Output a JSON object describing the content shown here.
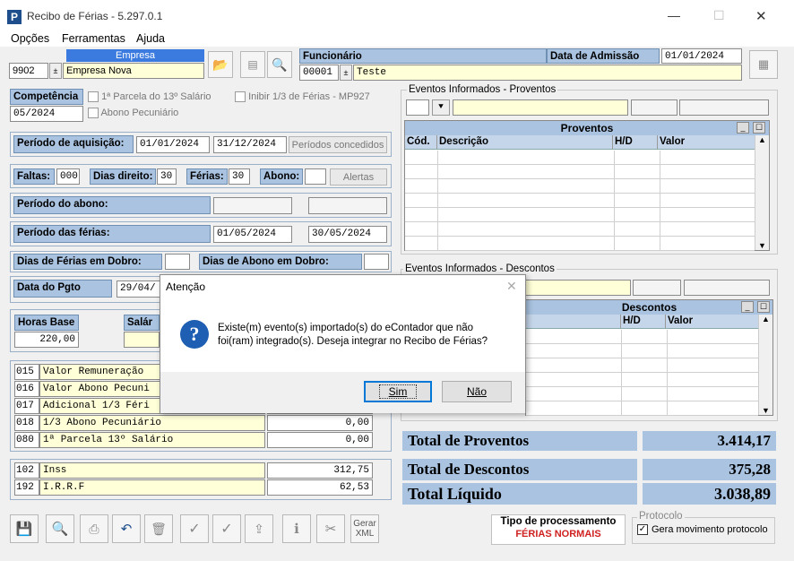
{
  "window": {
    "title": "Recibo de Férias - 5.297.0.1",
    "minimize": "—",
    "maximize": "☐",
    "close": "✕"
  },
  "menu": [
    "Opções",
    "Ferramentas",
    "Ajuda"
  ],
  "empresa": {
    "label": "Empresa",
    "code": "9902",
    "name": "Empresa Nova"
  },
  "funcionario": {
    "label": "Funcionário",
    "code": "00001",
    "name": "Teste"
  },
  "admissao": {
    "label": "Data de Admissão",
    "value": "01/01/2024"
  },
  "competencia": {
    "label": "Competência",
    "value": "05/2024",
    "parcela13_label": "1ª Parcela do 13º Salário",
    "abono_label": "Abono Pecuniário",
    "inibir_label": "Inibir 1/3 de Férias - MP927"
  },
  "aquisicao": {
    "label": "Período de aquisição:",
    "start": "01/01/2024",
    "end": "31/12/2024",
    "button": "Períodos concedidos"
  },
  "faltas": {
    "faltas_label": "Faltas:",
    "faltas_value": "000",
    "direito_label": "Dias direito:",
    "direito_value": "30",
    "ferias_label": "Férias:",
    "ferias_value": "30",
    "abono_label": "Abono:",
    "abono_value": "",
    "alertas_button": "Alertas"
  },
  "periodo_abono": {
    "label": "Período do abono:"
  },
  "periodo_ferias": {
    "label": "Período das férias:",
    "start": "01/05/2024",
    "end": "30/05/2024"
  },
  "dobro": {
    "ferias_label": "Dias de Férias em Dobro:",
    "abono_label": "Dias de Abono em Dobro:"
  },
  "pagto": {
    "label": "Data do Pgto",
    "value": "29/04/"
  },
  "horas": {
    "label": "Horas Base",
    "value": "220,00",
    "salario_label": "Salár"
  },
  "eventos": [
    {
      "code": "015",
      "desc": "Valor Remuneração",
      "value": ""
    },
    {
      "code": "016",
      "desc": "Valor Abono Pecuni",
      "value": ""
    },
    {
      "code": "017",
      "desc": "Adicional 1/3 Féri",
      "value": ""
    },
    {
      "code": "018",
      "desc": "1/3 Abono Pecuniário",
      "value": "0,00"
    },
    {
      "code": "080",
      "desc": "1ª Parcela 13º Salário",
      "value": "0,00"
    }
  ],
  "descontos_list": [
    {
      "code": "102",
      "desc": "Inss",
      "value": "312,75"
    },
    {
      "code": "192",
      "desc": "I.R.R.F",
      "value": "62,53"
    }
  ],
  "proventos_group": {
    "title": "Eventos Informados - Proventos",
    "grid_title": "Proventos",
    "cols": [
      "Cód.",
      "Descrição",
      "H/D",
      "Valor"
    ]
  },
  "descontos_group": {
    "title": "Eventos Informados - Descontos",
    "grid_title": "Descontos",
    "cols": [
      "H/D",
      "Valor"
    ]
  },
  "totais": {
    "proventos_label": "Total de Proventos",
    "proventos_value": "3.414,17",
    "descontos_label": "Total de Descontos",
    "descontos_value": "375,28",
    "liquido_label": "Total Líquido",
    "liquido_value": "3.038,89"
  },
  "processamento": {
    "label": "Tipo de processamento",
    "value": "FÉRIAS NORMAIS"
  },
  "protocolo": {
    "label": "Protocolo",
    "checkbox_label": "Gera movimento protocolo",
    "checked": "✓"
  },
  "toolbar": {
    "gerar_xml_1": "Gerar",
    "gerar_xml_2": "XML"
  },
  "dialog": {
    "title": "Atenção",
    "message_line1": "Existe(m) evento(s) importado(s) do eContador que não",
    "message_line2": "foi(ram) integrado(s). Deseja integrar no Recibo de Férias?",
    "yes": "Sim",
    "no": "Não",
    "close": "✕"
  }
}
